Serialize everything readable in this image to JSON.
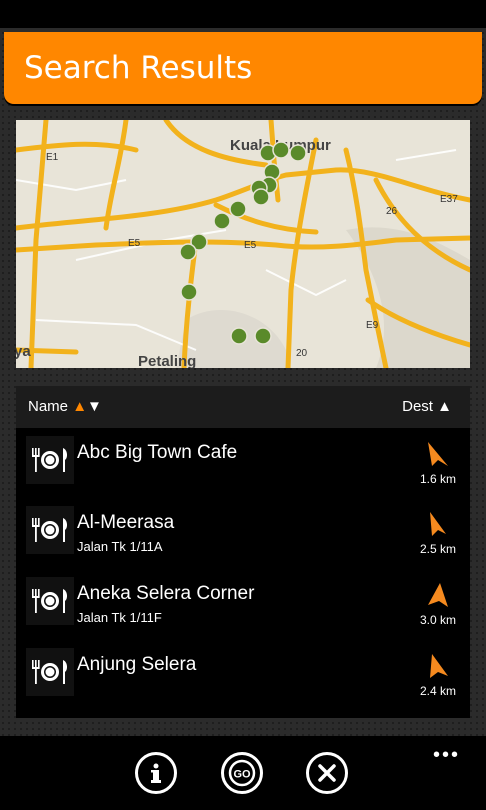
{
  "header": {
    "title": "Search Results"
  },
  "map": {
    "labels": {
      "city_top": "Kuala Lumpur",
      "city_bottom": "Petaling",
      "road_e5": "E5",
      "road_e37": "E37",
      "road_26": "26",
      "road_e9": "E9",
      "road_20": "20",
      "road_1": "1",
      "road_e1": "E1",
      "edge_left": "ya",
      "edge_top": "Petaling Jaya"
    },
    "colors": {
      "road": "#f2b21c",
      "marker": "#5a8a2a",
      "land": "#e8e4d8"
    }
  },
  "list": {
    "header_name": "Name",
    "header_dest": "Dest",
    "items": [
      {
        "name": "Abc Big Town Cafe",
        "address": "",
        "distance": "1.6 km",
        "icon": "restaurant-icon"
      },
      {
        "name": "Al-Meerasa",
        "address": "Jalan Tk 1/11A",
        "distance": "2.5 km",
        "icon": "restaurant-icon"
      },
      {
        "name": "Aneka Selera Corner",
        "address": "Jalan Tk 1/11F",
        "distance": "3.0 km",
        "icon": "restaurant-icon"
      },
      {
        "name": "Anjung Selera",
        "address": "",
        "distance": "2.4 km",
        "icon": "restaurant-icon"
      }
    ]
  },
  "app_bar": {
    "buttons": [
      "info-icon",
      "go-icon",
      "close-icon"
    ],
    "go_label": "GO",
    "more": "•••"
  }
}
